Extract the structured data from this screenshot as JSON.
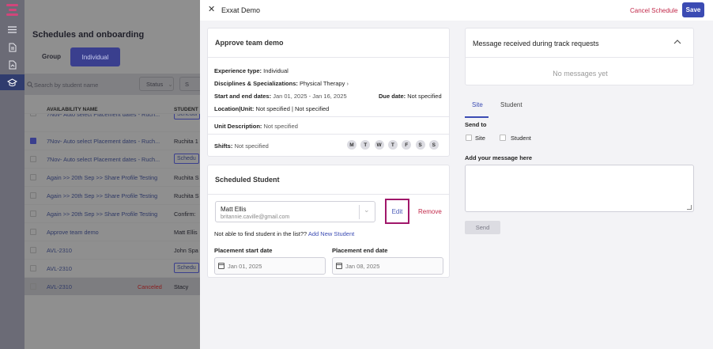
{
  "background_page": {
    "title": "Schedules and onboarding",
    "tabs": [
      "Group",
      "Individual"
    ],
    "search_placeholder": "Search by student name",
    "status_filter": "Status",
    "second_filter": "S",
    "columns": [
      "AVAILABILITY NAME",
      "STUDENT"
    ],
    "rows": [
      {
        "name": "7Nov- Auto select Placement dates - Ruch...",
        "student": "Schedul",
        "chip": true,
        "checked": false
      },
      {
        "name": "7Nov- Auto select Placement dates - Ruch...",
        "student": "Ruchita 1",
        "chip": false,
        "checked": true
      },
      {
        "name": "7Nov- Auto select Placement dates - Ruch...",
        "student": "Schedu",
        "chip": true,
        "checked": false
      },
      {
        "name": "Again >> 20th Sep >> Share Profile Testing",
        "student": "Ruchita S",
        "chip": false,
        "checked": false
      },
      {
        "name": "Again >> 20th Sep >> Share Profile Testing",
        "student": "Ruchita S",
        "chip": false,
        "checked": false
      },
      {
        "name": "Again >> 20th Sep >> Share Profile Testing",
        "student": "Confirm:",
        "chip": false,
        "checked": false
      },
      {
        "name": "Approve team demo",
        "student": "Matt Ellis",
        "chip": false,
        "checked": false
      },
      {
        "name": "AVL-2310",
        "student": "John Spa",
        "chip": false,
        "checked": false
      },
      {
        "name": "AVL-2310",
        "student": "Schedu",
        "chip": true,
        "checked": false
      },
      {
        "name": "AVL-2310",
        "student": "Stacy",
        "chip": false,
        "checked": false,
        "status": "Canceled"
      }
    ]
  },
  "drawer": {
    "title": "Exxat Demo",
    "cancel_label": "Cancel Schedule",
    "save_label": "Save",
    "details": {
      "header": "Approve team demo",
      "experience_label": "Experience type:",
      "experience_value": "Individual",
      "disciplines_label": "Disciplines & Specializations:",
      "disciplines_value": "Physical Therapy",
      "dates_label": "Start and end dates:",
      "dates_value": "Jan 01, 2025 - Jan 16, 2025",
      "due_label": "Due date:",
      "due_value": "Not specified",
      "location_label": "Location|Unit:",
      "location_value": "Not specified | Not specified",
      "unit_desc_label": "Unit Description:",
      "unit_desc_value": "Not specified",
      "shifts_label": "Shifts:",
      "shifts_value": "Not specified",
      "days": [
        "M",
        "T",
        "W",
        "T",
        "F",
        "S",
        "S"
      ]
    },
    "scheduled": {
      "header": "Scheduled Student",
      "student_name": "Matt Ellis",
      "student_email": "britannie.caville@gmail.com",
      "edit_label": "Edit",
      "remove_label": "Remove",
      "not_found_text": "Not able to find student in the list??",
      "add_new_label": "Add New Student",
      "start_label": "Placement start date",
      "start_value": "Jan 01, 2025",
      "end_label": "Placement end date",
      "end_value": "Jan 08, 2025"
    },
    "messages": {
      "header": "Message received during track requests",
      "empty_text": "No messages yet",
      "tabs": [
        "Site",
        "Student"
      ],
      "send_to_label": "Send to",
      "send_to_options": [
        "Site",
        "Student"
      ],
      "add_message_label": "Add your message here",
      "send_label": "Send"
    }
  },
  "colors": {
    "accent": "#3b4bb3",
    "danger": "#c2294a",
    "highlight": "#a0176a"
  }
}
